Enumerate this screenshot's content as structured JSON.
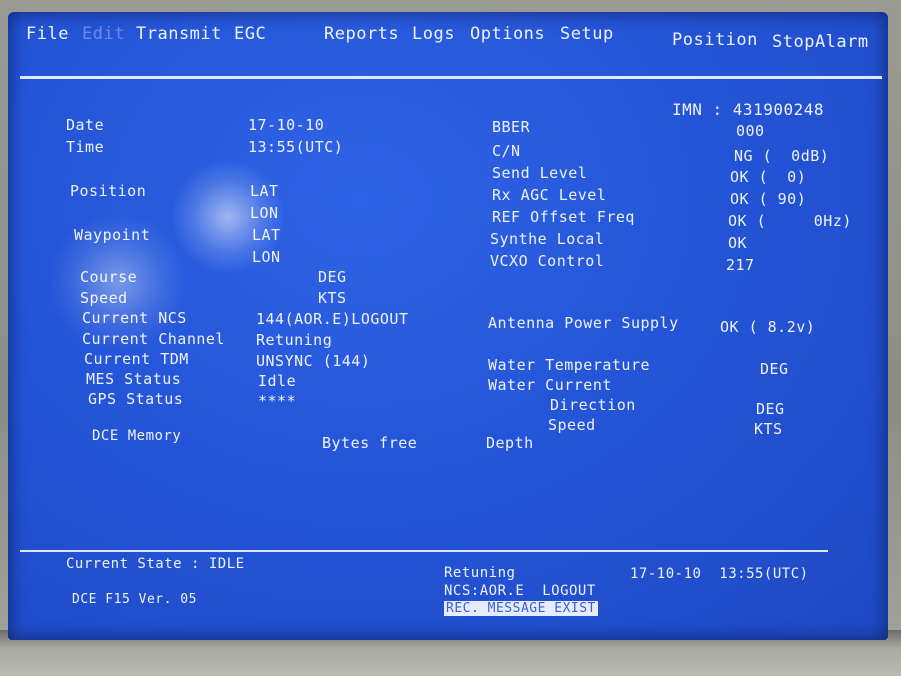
{
  "menu": {
    "file": "File",
    "edit": "Edit",
    "transmit": "Transmit",
    "egc": "EGC",
    "reports": "Reports",
    "logs": "Logs",
    "options": "Options",
    "setup": "Setup",
    "position": "Position",
    "stopalarm": "StopAlarm"
  },
  "imn": "IMN : 431900248",
  "left": {
    "date_label": "Date",
    "date_value": "17-10-10",
    "time_label": "Time",
    "time_value": "13:55(UTC)",
    "position_label": "Position",
    "position_lat": "LAT",
    "position_lon": "LON",
    "waypoint_label": "Waypoint",
    "waypoint_lat": "LAT",
    "waypoint_lon": "LON",
    "course_label": "Course",
    "course_unit": "DEG",
    "speed_label": "Speed",
    "speed_unit": "KTS",
    "ncs_label": "Current NCS",
    "ncs_value": "144(AOR.E)LOGOUT",
    "channel_label": "Current Channel",
    "channel_value": "Retuning",
    "tdm_label": "Current TDM",
    "tdm_value": "UNSYNC (144)",
    "mes_label": "MES Status",
    "mes_value": "Idle",
    "gps_label": "GPS Status",
    "gps_value": "****",
    "dce_memory_label": "DCE Memory",
    "bytes_free": "Bytes free"
  },
  "right": {
    "bber_label": "BBER",
    "bber_value": "000",
    "cn_label": "C/N",
    "cn_value": "NG (  0dB)",
    "send_label": "Send Level",
    "send_value": "OK (  0)",
    "rxagc_label": "Rx AGC Level",
    "rxagc_value": "OK ( 90)",
    "ref_label": "REF Offset Freq",
    "ref_value": "OK (     0Hz)",
    "synthe_label": "Synthe Local",
    "synthe_value": "OK",
    "vcxo_label": "VCXO Control",
    "vcxo_value": "217",
    "antenna_label": "Antenna Power Supply",
    "antenna_value": "OK ( 8.2v)",
    "water_temp_label": "Water Temperature",
    "water_temp_unit": "DEG",
    "water_current_label": "Water Current",
    "direction_label": "Direction",
    "direction_unit": "DEG",
    "speed_label": "Speed",
    "speed_unit": "KTS",
    "depth_label": "Depth"
  },
  "status": {
    "current_state": "Current State : IDLE",
    "version": "DCE F15 Ver. 05",
    "retuning": "Retuning",
    "ncs": "NCS:AOR.E  LOGOUT",
    "message": "REC. MESSAGE EXIST",
    "datetime": "17-10-10  13:55(UTC)"
  }
}
